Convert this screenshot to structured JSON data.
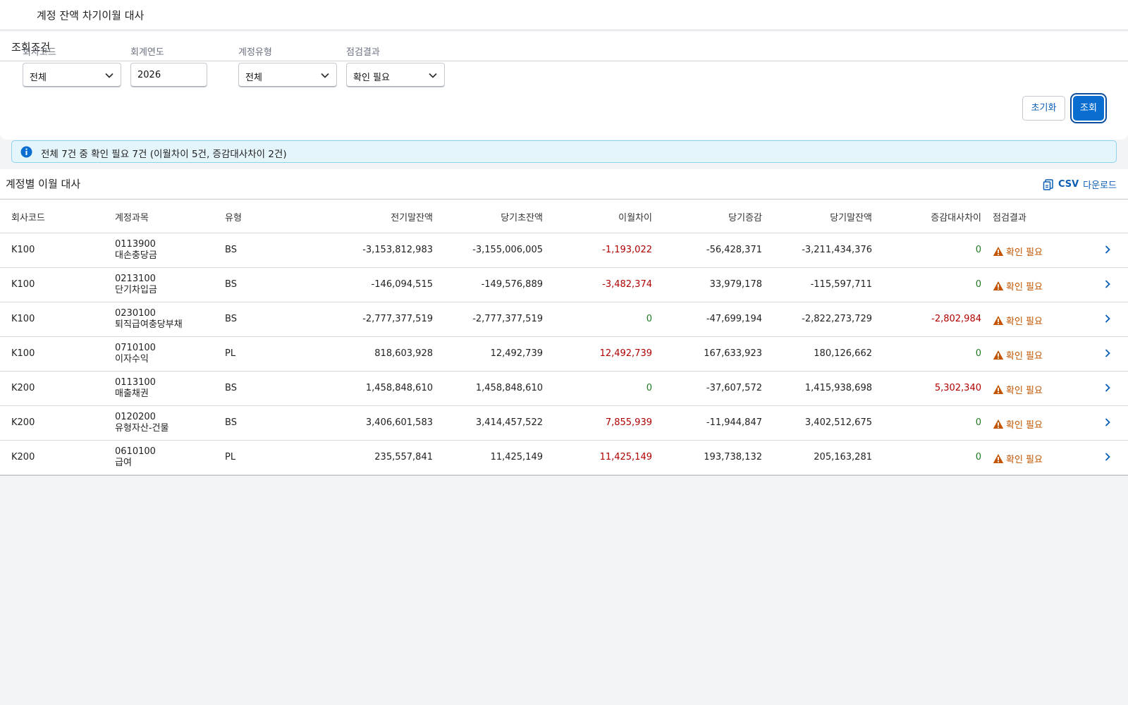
{
  "app": {
    "title": "계정 잔액 차기이월 대사"
  },
  "filter": {
    "header": "조회조건",
    "company_code": {
      "label": "회사코드",
      "value": "전체"
    },
    "fiscal_year": {
      "label": "회계연도",
      "value": "2026"
    },
    "account_type": {
      "label": "계정유형",
      "value": "전체"
    },
    "check_result": {
      "label": "점검결과",
      "value": "확인 필요"
    },
    "reset_label": "초기화",
    "search_label": "조회"
  },
  "info_message": "전체 7건 중 확인 필요 7건 (이월차이 5건, 증감대사차이 2건)",
  "table": {
    "title": "계정별 이월 대사",
    "csv_prefix": "CSV",
    "csv_label": "다운로드",
    "columns": [
      "회사코드",
      "계정과목",
      "유형",
      "전기말잔액",
      "당기초잔액",
      "이월차이",
      "당기증감",
      "당기말잔액",
      "증감대사차이",
      "점검결과"
    ],
    "rows": [
      {
        "company": "K100",
        "account_code": "0113900",
        "account_name": "대손충당금",
        "type": "BS",
        "prev_end": "-3,153,812,983",
        "curr_begin": "-3,155,006,005",
        "carry_diff": "-1,193,022",
        "curr_change": "-56,428,371",
        "curr_end": "-3,211,434,376",
        "recon_diff": "0",
        "status": "확인 필요"
      },
      {
        "company": "K100",
        "account_code": "0213100",
        "account_name": "단기차입금",
        "type": "BS",
        "prev_end": "-146,094,515",
        "curr_begin": "-149,576,889",
        "carry_diff": "-3,482,374",
        "curr_change": "33,979,178",
        "curr_end": "-115,597,711",
        "recon_diff": "0",
        "status": "확인 필요"
      },
      {
        "company": "K100",
        "account_code": "0230100",
        "account_name": "퇴직급여충당부채",
        "type": "BS",
        "prev_end": "-2,777,377,519",
        "curr_begin": "-2,777,377,519",
        "carry_diff": "0",
        "curr_change": "-47,699,194",
        "curr_end": "-2,822,273,729",
        "recon_diff": "-2,802,984",
        "status": "확인 필요"
      },
      {
        "company": "K100",
        "account_code": "0710100",
        "account_name": "이자수익",
        "type": "PL",
        "prev_end": "818,603,928",
        "curr_begin": "12,492,739",
        "carry_diff": "12,492,739",
        "curr_change": "167,633,923",
        "curr_end": "180,126,662",
        "recon_diff": "0",
        "status": "확인 필요"
      },
      {
        "company": "K200",
        "account_code": "0113100",
        "account_name": "매출채권",
        "type": "BS",
        "prev_end": "1,458,848,610",
        "curr_begin": "1,458,848,610",
        "carry_diff": "0",
        "curr_change": "-37,607,572",
        "curr_end": "1,415,938,698",
        "recon_diff": "5,302,340",
        "status": "확인 필요"
      },
      {
        "company": "K200",
        "account_code": "0120200",
        "account_name": "유형자산-건물",
        "type": "BS",
        "prev_end": "3,406,601,583",
        "curr_begin": "3,414,457,522",
        "carry_diff": "7,855,939",
        "curr_change": "-11,944,847",
        "curr_end": "3,402,512,675",
        "recon_diff": "0",
        "status": "확인 필요"
      },
      {
        "company": "K200",
        "account_code": "0610100",
        "account_name": "급여",
        "type": "PL",
        "prev_end": "235,557,841",
        "curr_begin": "11,425,149",
        "carry_diff": "11,425,149",
        "curr_change": "193,738,132",
        "curr_end": "205,163,281",
        "recon_diff": "0",
        "status": "확인 필요"
      }
    ]
  },
  "colors": {
    "accent": "#0a6ed1",
    "negative": "#b00000",
    "zero": "#1f7a1f",
    "warning": "#c35500",
    "info_bg": "#e5f5fc"
  },
  "icons": {
    "info": "info-icon",
    "warning": "warning-icon",
    "chevron": "chevron-right-icon",
    "csv": "csv-download-icon",
    "dropdown": "chevron-down-icon"
  }
}
